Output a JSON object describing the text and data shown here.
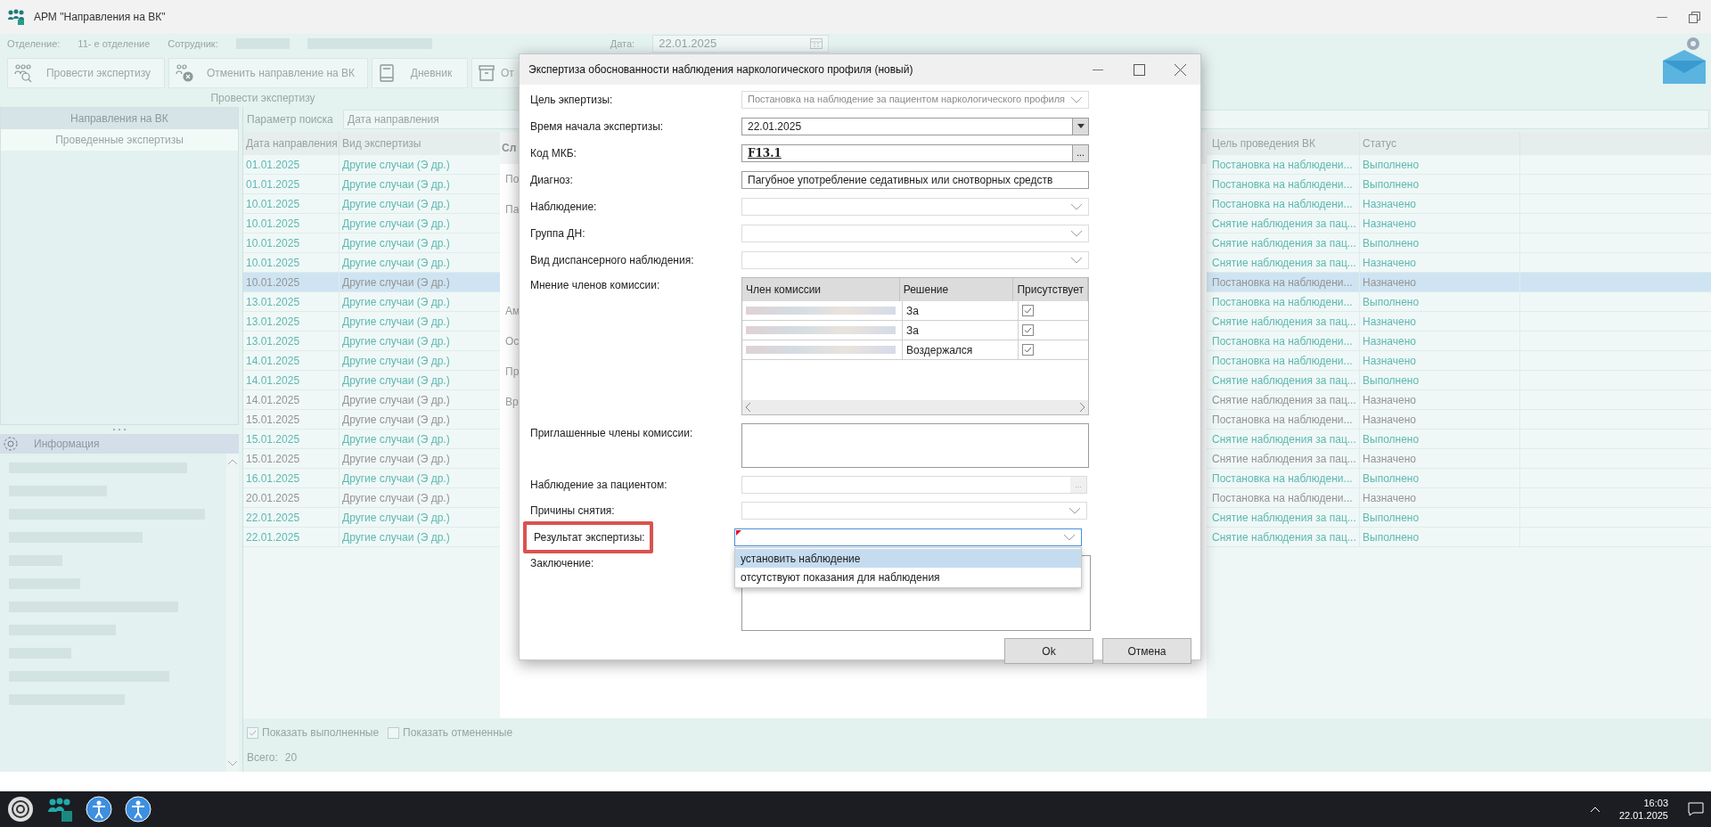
{
  "window": {
    "title": "АРМ \"Направления на ВК\""
  },
  "info_bar": {
    "department_label": "Отделение:",
    "department": "11- е отделение",
    "employee_label": "Сотрудник:",
    "date_label": "Дата:",
    "date": "22.01.2025"
  },
  "toolbar": {
    "buttons": [
      {
        "label": "Провести экспертизу",
        "kind": "people"
      },
      {
        "label": "Отменить направление на ВК",
        "kind": "cancel"
      },
      {
        "label": "Дневник",
        "kind": "book"
      },
      {
        "label": "От",
        "kind": "box"
      }
    ],
    "group_label": "Провести экспертизу"
  },
  "nav": [
    {
      "label": "Направления на ВК",
      "selected": true
    },
    {
      "label": "Проведенные экспертизы",
      "selected": false
    }
  ],
  "info_panel": {
    "title": "Информация"
  },
  "search": {
    "label": "Параметр поиска",
    "value": "Дата направления"
  },
  "table": {
    "columns": [
      "Дата направления",
      "Вид экспертизы",
      "Цель проведения ВК",
      "Статус"
    ],
    "rows": [
      {
        "date": "01.01.2025",
        "type": "Другие случаи (Э др.)",
        "goal": "Постановка на наблюдени...",
        "status": "Выполнено",
        "muted": false,
        "selected": false
      },
      {
        "date": "01.01.2025",
        "type": "Другие случаи (Э др.)",
        "goal": "Постановка на наблюдени...",
        "status": "Выполнено",
        "muted": false,
        "selected": false
      },
      {
        "date": "10.01.2025",
        "type": "Другие случаи (Э др.)",
        "goal": "Постановка на наблюдени...",
        "status": "Назначено",
        "muted": false,
        "selected": false
      },
      {
        "date": "10.01.2025",
        "type": "Другие случаи (Э др.)",
        "goal": "Снятие наблюдения за пац...",
        "status": "Назначено",
        "muted": false,
        "selected": false
      },
      {
        "date": "10.01.2025",
        "type": "Другие случаи (Э др.)",
        "goal": "Снятие наблюдения за пац...",
        "status": "Выполнено",
        "muted": false,
        "selected": false
      },
      {
        "date": "10.01.2025",
        "type": "Другие случаи (Э др.)",
        "goal": "Снятие наблюдения за пац...",
        "status": "Назначено",
        "muted": false,
        "selected": false
      },
      {
        "date": "10.01.2025",
        "type": "Другие случаи (Э др.)",
        "goal": "Постановка на наблюдени...",
        "status": "Назначено",
        "muted": true,
        "selected": true
      },
      {
        "date": "13.01.2025",
        "type": "Другие случаи (Э др.)",
        "goal": "Постановка на наблюдени...",
        "status": "Выполнено",
        "muted": false,
        "selected": false
      },
      {
        "date": "13.01.2025",
        "type": "Другие случаи (Э др.)",
        "goal": "Снятие наблюдения за пац...",
        "status": "Назначено",
        "muted": false,
        "selected": false
      },
      {
        "date": "13.01.2025",
        "type": "Другие случаи (Э др.)",
        "goal": "Постановка на наблюдени...",
        "status": "Назначено",
        "muted": false,
        "selected": false
      },
      {
        "date": "14.01.2025",
        "type": "Другие случаи (Э др.)",
        "goal": "Постановка на наблюдени...",
        "status": "Назначено",
        "muted": false,
        "selected": false
      },
      {
        "date": "14.01.2025",
        "type": "Другие случаи (Э др.)",
        "goal": "Снятие наблюдения за пац...",
        "status": "Выполнено",
        "muted": false,
        "selected": false
      },
      {
        "date": "14.01.2025",
        "type": "Другие случаи (Э др.)",
        "goal": "Снятие наблюдения за пац...",
        "status": "Назначено",
        "muted": true,
        "selected": false
      },
      {
        "date": "15.01.2025",
        "type": "Другие случаи (Э др.)",
        "goal": "Постановка на наблюдени...",
        "status": "Назначено",
        "muted": true,
        "selected": false
      },
      {
        "date": "15.01.2025",
        "type": "Другие случаи (Э др.)",
        "goal": "Снятие наблюдения за пац...",
        "status": "Выполнено",
        "muted": false,
        "selected": false
      },
      {
        "date": "15.01.2025",
        "type": "Другие случаи (Э др.)",
        "goal": "Снятие наблюдения за пац...",
        "status": "Назначено",
        "muted": true,
        "selected": false
      },
      {
        "date": "16.01.2025",
        "type": "Другие случаи (Э др.)",
        "goal": "Постановка на наблюдени...",
        "status": "Выполнено",
        "muted": false,
        "selected": false
      },
      {
        "date": "20.01.2025",
        "type": "Другие случаи (Э др.)",
        "goal": "Постановка на наблюдени...",
        "status": "Назначено",
        "muted": true,
        "selected": false
      },
      {
        "date": "22.01.2025",
        "type": "Другие случаи (Э др.)",
        "goal": "Снятие наблюдения за пац...",
        "status": "Выполнено",
        "muted": false,
        "selected": false
      },
      {
        "date": "22.01.2025",
        "type": "Другие случаи (Э др.)",
        "goal": "Снятие наблюдения за пац...",
        "status": "Выполнено",
        "muted": false,
        "selected": false
      }
    ]
  },
  "details": {
    "header": "Сл",
    "labels": [
      "По",
      "Па",
      "Ам",
      "Ос",
      "Пр",
      "Вр"
    ]
  },
  "footer": {
    "checkboxes": [
      {
        "label": "Показать выполненные",
        "checked": true
      },
      {
        "label": "Показать отмененные",
        "checked": false
      }
    ],
    "total_label": "Всего:",
    "total": "20"
  },
  "dialog": {
    "title": "Экспертиза обоснованности наблюдения наркологического профиля (новый)",
    "fields": [
      {
        "label": "Цель экпертизы:",
        "kind": "combo",
        "value": "Постановка на наблюдение за пациентом наркологического профиля",
        "disabled": true
      },
      {
        "label": "Время начала экспертизы:",
        "kind": "date",
        "value": "22.01.2025"
      },
      {
        "label": "Код МКБ:",
        "kind": "lookup",
        "value": "F13.1",
        "button": "..."
      },
      {
        "label": "Диагноз:",
        "kind": "text",
        "value": "Пагубное употребление седативных или снотворных средств"
      },
      {
        "label": "Наблюдение:",
        "kind": "combo",
        "disabled": true
      },
      {
        "label": "Группа ДН:",
        "kind": "combo",
        "disabled": true
      },
      {
        "label": "Вид диспансерного наблюдения:",
        "kind": "combo",
        "disabled": true
      }
    ],
    "commission": {
      "label": "Мнение членов комиссии:",
      "columns": [
        "Член комиссии",
        "Решение",
        "Присутствует"
      ],
      "rows": [
        {
          "decision": "За",
          "present": true
        },
        {
          "decision": "За",
          "present": true
        },
        {
          "decision": "Воздержался",
          "present": true
        }
      ]
    },
    "invited_label": "Приглашенные члены комиссии:",
    "observation": {
      "label": "Наблюдение за пациентом:",
      "button": "..."
    },
    "reasons_label": "Причины снятия:",
    "result": {
      "label": "Результат экспертизы:",
      "highlighted": true,
      "options": [
        {
          "label": "установить наблюдение",
          "selected": true
        },
        {
          "label": "отсутствуют показания для наблюдения",
          "selected": false
        }
      ]
    },
    "conclusion_label": "Заключение:",
    "buttons": [
      "Ok",
      "Отмена"
    ]
  },
  "taskbar": {
    "time": "16:03",
    "date": "22.01.2025"
  }
}
